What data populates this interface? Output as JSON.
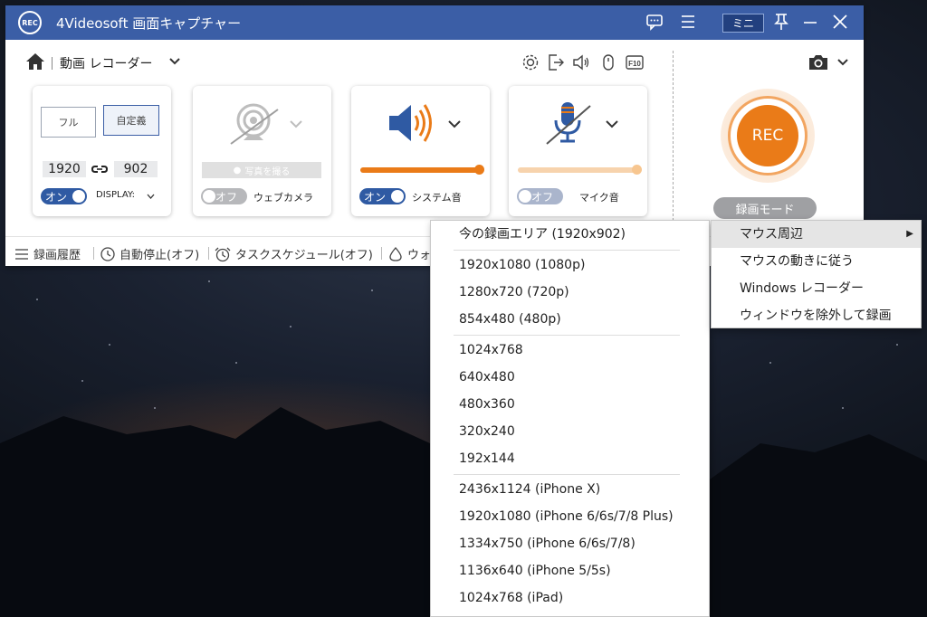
{
  "window": {
    "logo_text": "REC",
    "title": "4Videosoft 画面キャプチャー",
    "mini_label": "ミニ",
    "title_bg": "#3b5ea6"
  },
  "toolbar": {
    "mode_label": "動画 レコーダー"
  },
  "area_card": {
    "full_label": "フル",
    "custom_label": "自定義",
    "width": "1920",
    "height": "902",
    "toggle_label": "オン",
    "display_label": "DISPLAY:"
  },
  "webcam_card": {
    "photo_button": "写真を撮る",
    "toggle_label": "オフ",
    "label": "ウェブカメラ"
  },
  "system_audio_card": {
    "toggle_label": "オン",
    "label": "システム音",
    "volume": 1.0
  },
  "mic_card": {
    "toggle_label": "オフ",
    "label": "マイク音",
    "volume": 1.0
  },
  "rec": {
    "label": "REC",
    "mode_label": "録画モード",
    "accent": "#ea7b18"
  },
  "statusbar": {
    "items": [
      "録画履歴",
      "自動停止(オフ)",
      "タスクスケジュール(オフ)",
      "ウォ"
    ]
  },
  "resolution_menu": {
    "groups": [
      [
        "今の録画エリア (1920x902)"
      ],
      [
        "1920x1080 (1080p)",
        "1280x720 (720p)",
        "854x480 (480p)"
      ],
      [
        "1024x768",
        "640x480",
        "480x360",
        "320x240",
        "192x144"
      ],
      [
        "2436x1124 (iPhone X)",
        "1920x1080 (iPhone 6/6s/7/8 Plus)",
        "1334x750 (iPhone 6/6s/7/8)",
        "1136x640 (iPhone 5/5s)",
        "1024x768 (iPad)"
      ]
    ]
  },
  "sub_menu": {
    "items": [
      "マウス周辺",
      "マウスの動きに従う",
      "Windows レコーダー",
      "ウィンドウを除外して録画"
    ]
  }
}
